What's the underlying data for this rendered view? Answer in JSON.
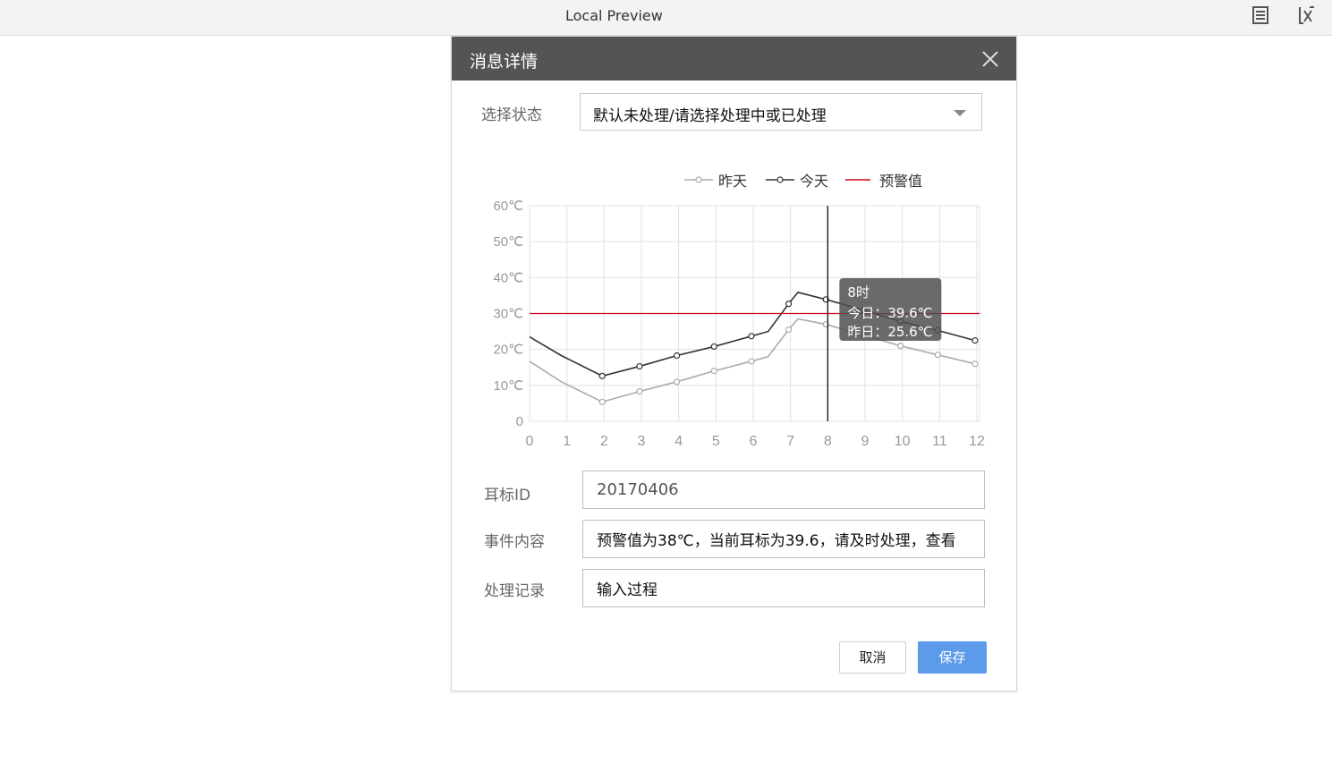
{
  "window": {
    "title": "Local Preview",
    "icons": [
      "document-icon",
      "close-x-icon"
    ]
  },
  "dialog": {
    "title": "消息详情",
    "status_label": "选择状态",
    "status_value": "默认未处理/请选择处理中或已处理",
    "fields": {
      "ear_tag_label": "耳标ID",
      "ear_tag_value": "20170406",
      "event_label": "事件内容",
      "event_value": "预警值为38℃，当前耳标为39.6，请及时处理，查看",
      "record_label": "处理记录",
      "record_value": "输入过程"
    },
    "buttons": {
      "cancel": "取消",
      "save": "保存"
    }
  },
  "chart_data": {
    "type": "line",
    "x": [
      0,
      1,
      2,
      3,
      4,
      5,
      6,
      7,
      8,
      9,
      10,
      11,
      12
    ],
    "xlim": [
      0,
      12
    ],
    "ylim": [
      0,
      60
    ],
    "yticks": [
      "0",
      "10℃",
      "20℃",
      "30℃",
      "40℃",
      "50℃",
      "60℃"
    ],
    "yticks_values": [
      0,
      10,
      20,
      30,
      40,
      50,
      60
    ],
    "series": [
      {
        "name": "昨天",
        "color": "#aaaaaa",
        "x": [
          0,
          0.85,
          1.95,
          2.95,
          3.95,
          4.95,
          5.95,
          6.4,
          6.95,
          7.2,
          7.95,
          8.95,
          9.95,
          10.95,
          11.95
        ],
        "values": [
          16.7,
          11,
          5.4,
          8.3,
          11,
          14,
          16.7,
          18,
          25.5,
          28.5,
          27,
          24,
          21,
          18.5,
          16
        ]
      },
      {
        "name": "今天",
        "color": "#333333",
        "x": [
          0,
          0.85,
          1.95,
          2.95,
          3.95,
          4.95,
          5.95,
          6.4,
          6.95,
          7.2,
          7.95,
          8.95,
          9.95,
          10.95,
          11.95
        ],
        "values": [
          23.5,
          18.3,
          12.6,
          15.3,
          18.3,
          20.8,
          23.7,
          25,
          32.7,
          35.9,
          33.9,
          31,
          27.8,
          25.3,
          22.5
        ]
      },
      {
        "name": "预警值",
        "color": "#d0021b",
        "type": "threshold",
        "value": 30
      }
    ],
    "legend_placement": "top-right",
    "tooltip": {
      "title": "8时",
      "line1": "今日：39.6℃",
      "line2": "昨日：25.6℃",
      "x": 8
    },
    "grid": true
  }
}
